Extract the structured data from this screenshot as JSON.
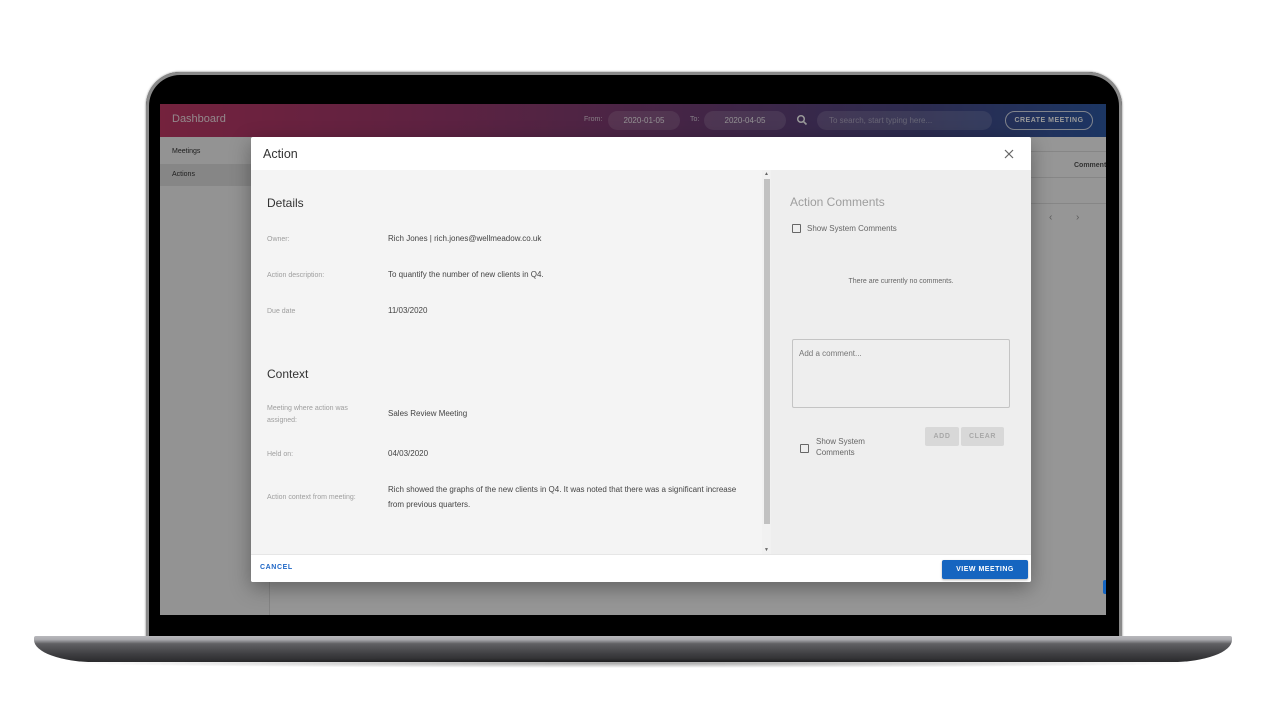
{
  "app": {
    "title": "Dashboard",
    "from_label": "From:",
    "from_value": "2020-01-05",
    "to_label": "To:",
    "to_value": "2020-04-05",
    "search_icon": "search-icon",
    "search_placeholder": "To search, start typing here...",
    "create_meeting_label": "CREATE MEETING"
  },
  "sidebar": {
    "items": [
      {
        "label": "Meetings",
        "active": false
      },
      {
        "label": "Actions",
        "active": true
      }
    ]
  },
  "background": {
    "column_header": "Comments",
    "prev_icon": "chevron-left-icon",
    "next_icon": "chevron-right-icon",
    "prev_glyph": "‹",
    "next_glyph": "›"
  },
  "dialog": {
    "title": "Action",
    "close_icon": "close-icon",
    "details": {
      "heading": "Details",
      "fields": [
        {
          "label": "Owner:",
          "value": "Rich Jones | rich.jones@wellmeadow.co.uk"
        },
        {
          "label": "Action description:",
          "value": "To quantify the number of new clients in Q4."
        },
        {
          "label": "Due date",
          "value": "11/03/2020"
        }
      ]
    },
    "context": {
      "heading": "Context",
      "fields": [
        {
          "label": "Meeting where action was assigned:",
          "value": "Sales Review Meeting"
        },
        {
          "label": "Held on:",
          "value": "04/03/2020"
        },
        {
          "label": "Action context from meeting:",
          "value": "Rich showed the graphs of the new clients in Q4. It was noted that there was a significant increase from previous quarters."
        }
      ]
    },
    "comments": {
      "heading": "Action Comments",
      "show_system_top_label": "Show System Comments",
      "show_system_top_checked": false,
      "empty_message": "There are currently no comments.",
      "comment_placeholder": "Add a comment...",
      "comment_value": "",
      "show_system_bottom_label": "Show System Comments",
      "show_system_bottom_checked": false,
      "add_label": "ADD",
      "clear_label": "CLEAR"
    },
    "footer": {
      "cancel_label": "CANCEL",
      "view_meeting_label": "VIEW MEETING"
    }
  },
  "colors": {
    "primary": "#1565c0",
    "header_gradient_start": "#c13a67",
    "header_gradient_end": "#2f5aa6"
  }
}
